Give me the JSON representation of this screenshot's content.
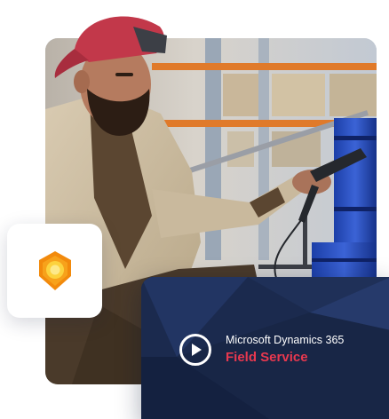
{
  "video_card": {
    "brand": "Microsoft Dynamics 365",
    "product": "Field Service",
    "product_color": "#e8384f",
    "background_color": "#1b2a4e",
    "play_icon": "play-circle-icon"
  },
  "app_card": {
    "icon": "field-service-app-icon",
    "icon_colors": [
      "#f7a21b",
      "#fcd23d",
      "#f28a0c"
    ]
  },
  "photo": {
    "subject": "warehouse-worker-scanning-photo"
  }
}
